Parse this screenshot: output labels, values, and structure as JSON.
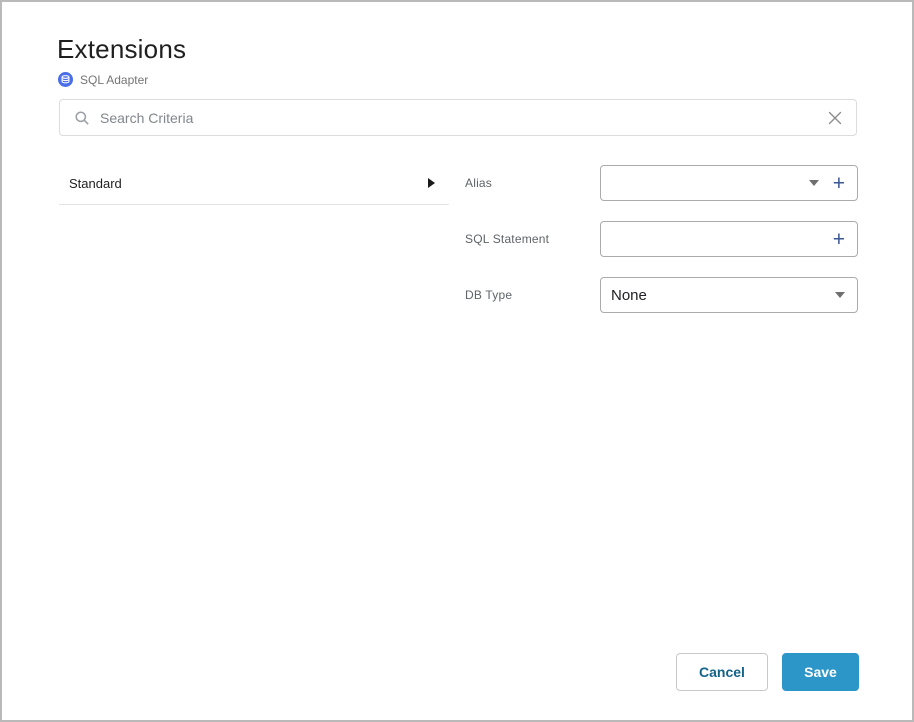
{
  "header": {
    "title": "Extensions",
    "adapter_label": "SQL Adapter"
  },
  "search": {
    "placeholder": "Search Criteria",
    "value": ""
  },
  "list": {
    "items": [
      {
        "label": "Standard"
      }
    ]
  },
  "form": {
    "fields": [
      {
        "label": "Alias",
        "value": "",
        "controls": [
          "dropdown",
          "add"
        ]
      },
      {
        "label": "SQL Statement",
        "value": "",
        "controls": [
          "add"
        ]
      },
      {
        "label": "DB Type",
        "value": "None",
        "controls": [
          "dropdown"
        ]
      }
    ]
  },
  "footer": {
    "cancel_label": "Cancel",
    "save_label": "Save"
  },
  "icons": {
    "plus_glyph": "+"
  },
  "colors": {
    "window_border": "#b9b9b9",
    "adapter_icon_bg": "#4a6ee8",
    "plus_icon": "#3a5795",
    "save_button_bg": "#2d96c8",
    "cancel_button_text": "#136289",
    "input_border": "#ababab",
    "search_border": "#dcdcdc"
  }
}
